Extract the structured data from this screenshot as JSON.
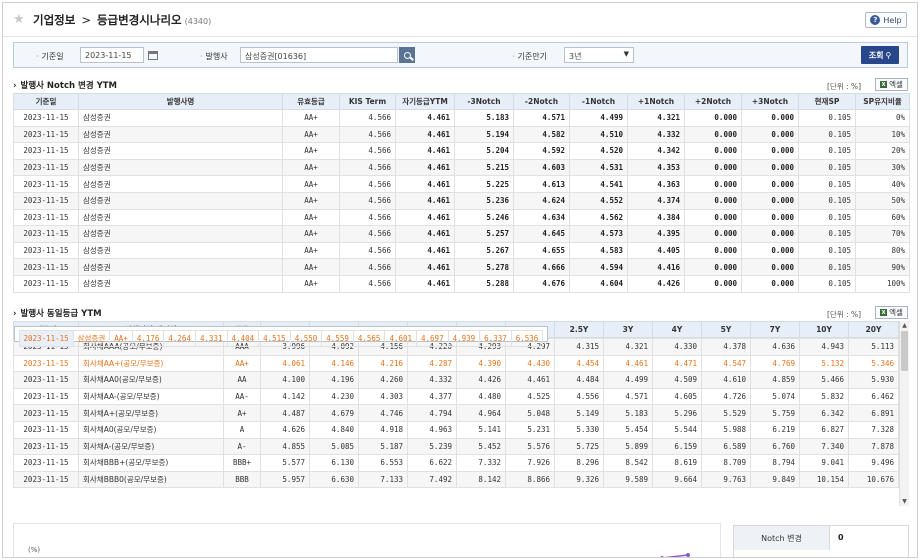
{
  "header": {
    "crumb_root": "기업정보",
    "crumb_sep": ">",
    "title": "등급변경시나리오",
    "code": "(4340)",
    "help_label": "Help"
  },
  "search": {
    "date_label": "기준일",
    "date_value": "2023-11-15",
    "issuer_label": "발행사",
    "issuer_value": "삼성증권[01636]",
    "period_label": "기준만기",
    "period_value": "3년",
    "query_label": "조회"
  },
  "section1": {
    "title": "발행사 Notch 변경 YTM",
    "unit": "[단위 : %]",
    "excel_label": "엑셀",
    "columns": [
      "기준일",
      "발행사명",
      "유효등급",
      "KIS Term",
      "자기등급YTM",
      "-3Notch",
      "-2Notch",
      "-1Notch",
      "+1Notch",
      "+2Notch",
      "+3Notch",
      "현재SP",
      "SP유지비율"
    ],
    "rows": [
      [
        "2023-11-15",
        "삼성증권",
        "AA+",
        "4.566",
        "4.461",
        "5.183",
        "4.571",
        "4.499",
        "4.321",
        "0.000",
        "0.000",
        "0.105",
        "0%"
      ],
      [
        "2023-11-15",
        "삼성증권",
        "AA+",
        "4.566",
        "4.461",
        "5.194",
        "4.582",
        "4.510",
        "4.332",
        "0.000",
        "0.000",
        "0.105",
        "10%"
      ],
      [
        "2023-11-15",
        "삼성증권",
        "AA+",
        "4.566",
        "4.461",
        "5.204",
        "4.592",
        "4.520",
        "4.342",
        "0.000",
        "0.000",
        "0.105",
        "20%"
      ],
      [
        "2023-11-15",
        "삼성증권",
        "AA+",
        "4.566",
        "4.461",
        "5.215",
        "4.603",
        "4.531",
        "4.353",
        "0.000",
        "0.000",
        "0.105",
        "30%"
      ],
      [
        "2023-11-15",
        "삼성증권",
        "AA+",
        "4.566",
        "4.461",
        "5.225",
        "4.613",
        "4.541",
        "4.363",
        "0.000",
        "0.000",
        "0.105",
        "40%"
      ],
      [
        "2023-11-15",
        "삼성증권",
        "AA+",
        "4.566",
        "4.461",
        "5.236",
        "4.624",
        "4.552",
        "4.374",
        "0.000",
        "0.000",
        "0.105",
        "50%"
      ],
      [
        "2023-11-15",
        "삼성증권",
        "AA+",
        "4.566",
        "4.461",
        "5.246",
        "4.634",
        "4.562",
        "4.384",
        "0.000",
        "0.000",
        "0.105",
        "60%"
      ],
      [
        "2023-11-15",
        "삼성증권",
        "AA+",
        "4.566",
        "4.461",
        "5.257",
        "4.645",
        "4.573",
        "4.395",
        "0.000",
        "0.000",
        "0.105",
        "70%"
      ],
      [
        "2023-11-15",
        "삼성증권",
        "AA+",
        "4.566",
        "4.461",
        "5.267",
        "4.655",
        "4.583",
        "4.405",
        "0.000",
        "0.000",
        "0.105",
        "80%"
      ],
      [
        "2023-11-15",
        "삼성증권",
        "AA+",
        "4.566",
        "4.461",
        "5.278",
        "4.666",
        "4.594",
        "4.416",
        "0.000",
        "0.000",
        "0.105",
        "90%"
      ],
      [
        "2023-11-15",
        "삼성증권",
        "AA+",
        "4.566",
        "4.461",
        "5.288",
        "4.676",
        "4.604",
        "4.426",
        "0.000",
        "0.000",
        "0.105",
        "100%"
      ]
    ]
  },
  "section2": {
    "title": "발행사 동일등급 YTM",
    "unit": "[단위 : %]",
    "excel_label": "엑셀",
    "columns": [
      "기준일",
      "발행사명/섹터명",
      "등급",
      "3M",
      "6M",
      "9M",
      "1Y",
      "1.5Y",
      "2Y",
      "2.5Y",
      "3Y",
      "4Y",
      "5Y",
      "7Y",
      "10Y",
      "20Y"
    ],
    "highlight_color": "#e8731a",
    "rows": [
      {
        "hl": true,
        "cells": [
          "2023-11-15",
          "삼성증권",
          "AA+",
          "4.176",
          "4.264",
          "4.331",
          "4.404",
          "4.515",
          "4.550",
          "4.559",
          "4.565",
          "4.601",
          "4.697",
          "4.939",
          "6.337",
          "6.536"
        ]
      },
      {
        "hl": false,
        "cells": [
          "2023-11-15",
          "회사채AAA(공모/무보증)",
          "AAA",
          "3.996",
          "4.092",
          "4.156",
          "4.220",
          "4.293",
          "4.297",
          "4.315",
          "4.321",
          "4.330",
          "4.378",
          "4.636",
          "4.943",
          "5.113"
        ]
      },
      {
        "hl": true,
        "cells": [
          "2023-11-15",
          "회사채AA+(공모/무보증)",
          "AA+",
          "4.061",
          "4.146",
          "4.216",
          "4.287",
          "4.390",
          "4.430",
          "4.454",
          "4.461",
          "4.471",
          "4.547",
          "4.769",
          "5.132",
          "5.346"
        ]
      },
      {
        "hl": false,
        "cells": [
          "2023-11-15",
          "회사채AA0(공모/무보증)",
          "AA",
          "4.100",
          "4.196",
          "4.260",
          "4.332",
          "4.426",
          "4.461",
          "4.484",
          "4.499",
          "4.509",
          "4.610",
          "4.859",
          "5.466",
          "5.930"
        ]
      },
      {
        "hl": false,
        "cells": [
          "2023-11-15",
          "회사채AA-(공모/무보증)",
          "AA-",
          "4.142",
          "4.230",
          "4.303",
          "4.377",
          "4.480",
          "4.525",
          "4.556",
          "4.571",
          "4.605",
          "4.726",
          "5.074",
          "5.832",
          "6.462"
        ]
      },
      {
        "hl": false,
        "cells": [
          "2023-11-15",
          "회사채A+(공모/무보증)",
          "A+",
          "4.487",
          "4.679",
          "4.746",
          "4.794",
          "4.964",
          "5.048",
          "5.149",
          "5.183",
          "5.296",
          "5.529",
          "5.759",
          "6.342",
          "6.891"
        ]
      },
      {
        "hl": false,
        "cells": [
          "2023-11-15",
          "회사채A0(공모/무보증)",
          "A",
          "4.626",
          "4.840",
          "4.918",
          "4.963",
          "5.141",
          "5.231",
          "5.330",
          "5.454",
          "5.544",
          "5.988",
          "6.219",
          "6.827",
          "7.328"
        ]
      },
      {
        "hl": false,
        "cells": [
          "2023-11-15",
          "회사채A-(공모/무보증)",
          "A-",
          "4.855",
          "5.085",
          "5.187",
          "5.239",
          "5.452",
          "5.576",
          "5.725",
          "5.899",
          "6.159",
          "6.589",
          "6.760",
          "7.340",
          "7.878"
        ]
      },
      {
        "hl": false,
        "cells": [
          "2023-11-15",
          "회사채BBB+(공모/무보증)",
          "BBB+",
          "5.577",
          "6.130",
          "6.553",
          "6.622",
          "7.332",
          "7.926",
          "8.296",
          "8.542",
          "8.619",
          "8.709",
          "8.794",
          "9.041",
          "9.496"
        ]
      },
      {
        "hl": false,
        "cells": [
          "2023-11-15",
          "회사채BBB0(공모/무보증)",
          "BBB",
          "5.957",
          "6.630",
          "7.133",
          "7.492",
          "8.142",
          "8.866",
          "9.326",
          "9.589",
          "9.664",
          "9.763",
          "9.849",
          "10.154",
          "10.676"
        ]
      }
    ]
  },
  "chart": {
    "ylabel": "(%)"
  },
  "panel": {
    "label": "Notch 변경",
    "value": "0"
  }
}
